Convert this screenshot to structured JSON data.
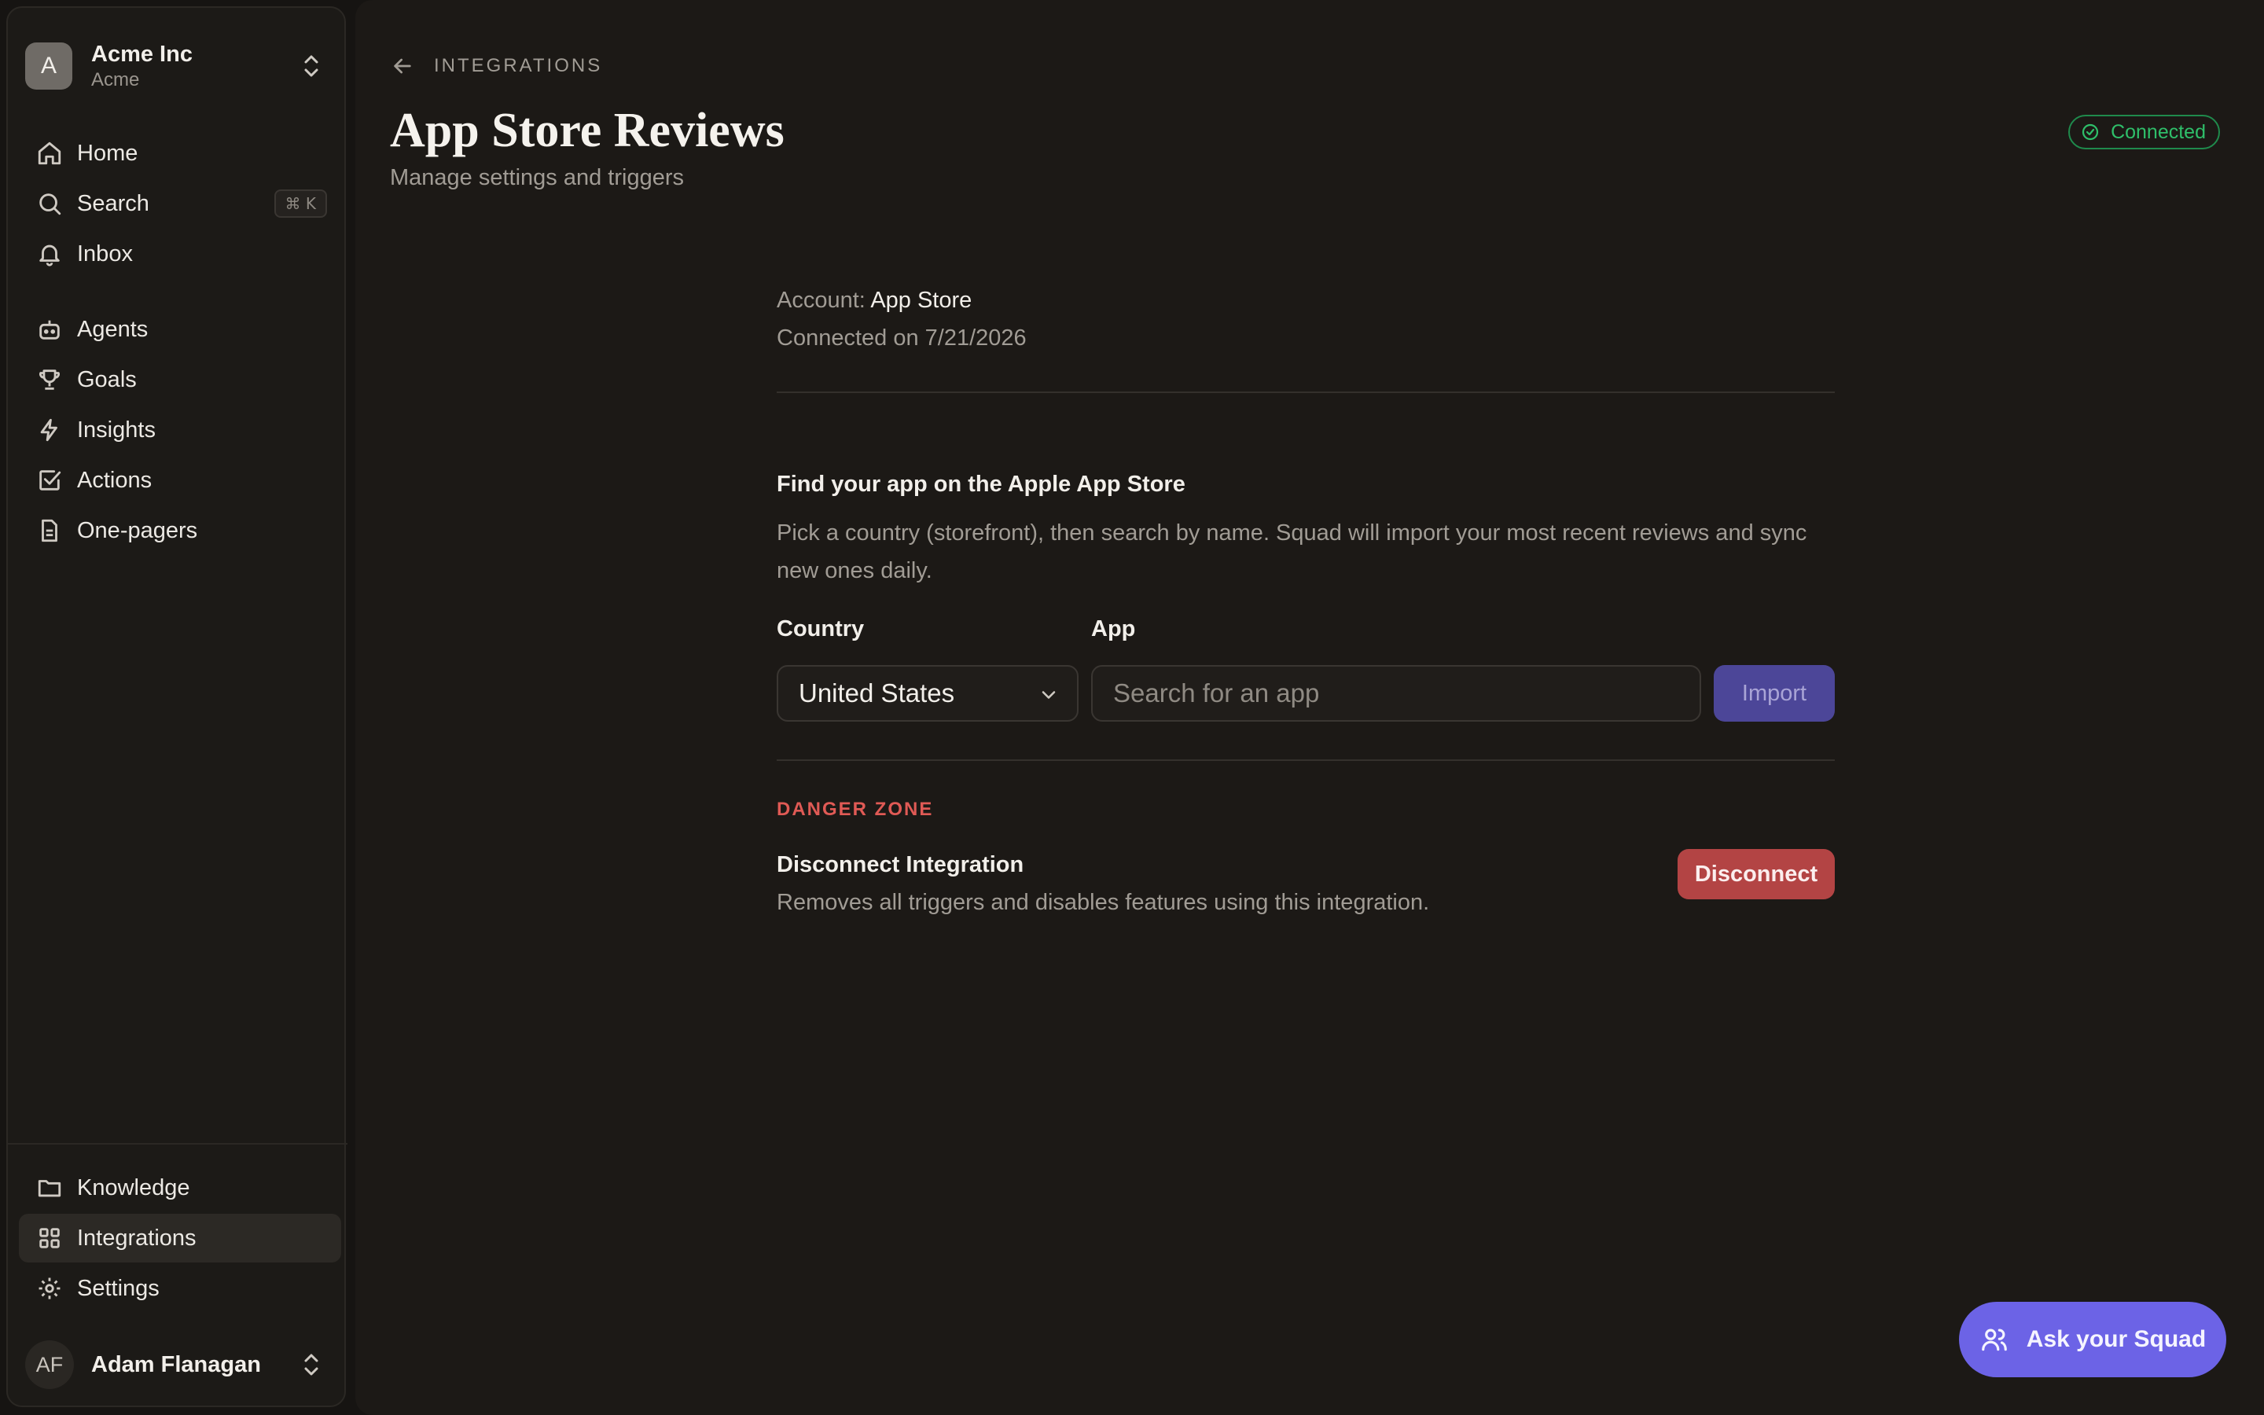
{
  "org": {
    "avatar_letter": "A",
    "name": "Acme Inc",
    "subtitle": "Acme"
  },
  "nav": {
    "primary": [
      {
        "label": "Home",
        "icon": "home-icon"
      },
      {
        "label": "Search",
        "icon": "search-icon",
        "shortcut": "⌘ K"
      },
      {
        "label": "Inbox",
        "icon": "bell-icon"
      }
    ],
    "secondary": [
      {
        "label": "Agents",
        "icon": "robot-icon"
      },
      {
        "label": "Goals",
        "icon": "trophy-icon"
      },
      {
        "label": "Insights",
        "icon": "lightning-icon"
      },
      {
        "label": "Actions",
        "icon": "checkbox-icon"
      },
      {
        "label": "One-pagers",
        "icon": "document-icon"
      }
    ],
    "bottom": [
      {
        "label": "Knowledge",
        "icon": "folder-icon"
      },
      {
        "label": "Integrations",
        "icon": "grid-icon",
        "active": true
      },
      {
        "label": "Settings",
        "icon": "gear-icon"
      }
    ]
  },
  "user": {
    "initials": "AF",
    "name": "Adam Flanagan"
  },
  "breadcrumb": {
    "label": "INTEGRATIONS"
  },
  "page": {
    "title": "App Store Reviews",
    "subtitle": "Manage settings and triggers",
    "status": "Connected"
  },
  "account": {
    "label": "Account:",
    "value": "App Store",
    "connected_on": "Connected on 7/21/2026"
  },
  "find_app": {
    "title": "Find your app on the Apple App Store",
    "description": "Pick a country (storefront), then search by name. Squad will import your most recent reviews and sync new ones daily.",
    "country_label": "Country",
    "country_value": "United States",
    "app_label": "App",
    "app_placeholder": "Search for an app",
    "import_label": "Import"
  },
  "danger": {
    "label": "DANGER ZONE",
    "title": "Disconnect Integration",
    "description": "Removes all triggers and disables features using this integration.",
    "button": "Disconnect"
  },
  "ask": {
    "label": "Ask your Squad"
  },
  "colors": {
    "accent": "#6c63e6",
    "danger": "#b34444",
    "success": "#2fbf6a"
  }
}
